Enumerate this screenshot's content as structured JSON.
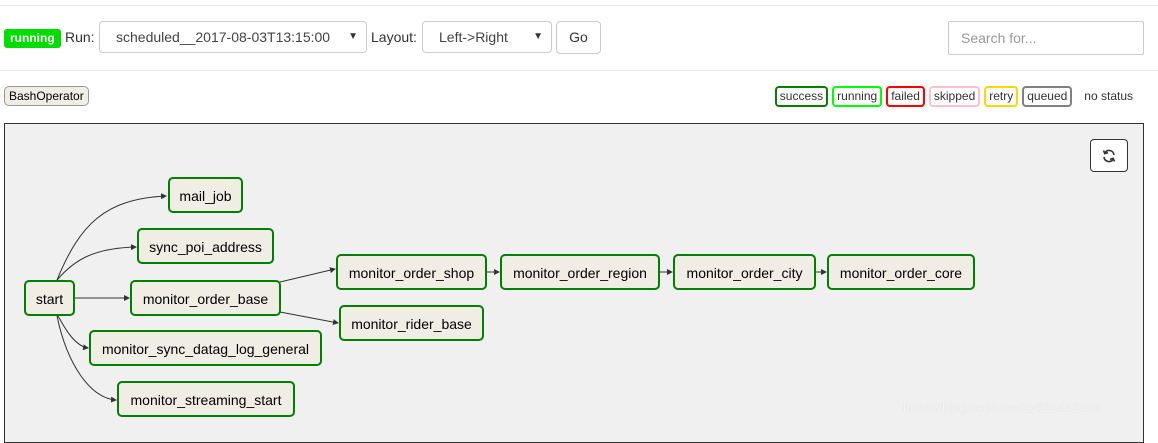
{
  "toolbar": {
    "state_badge": "running",
    "run_label": "Run:",
    "run_value": "scheduled__2017-08-03T13:15:00",
    "layout_label": "Layout:",
    "layout_value": "Left->Right",
    "go_label": "Go",
    "search_placeholder": "Search for..."
  },
  "operator_tag": "BashOperator",
  "legend": {
    "items": [
      {
        "label": "success",
        "color": "#008000"
      },
      {
        "label": "running",
        "color": "#00ff00"
      },
      {
        "label": "failed",
        "color": "#ff0000"
      },
      {
        "label": "skipped",
        "color": "#ffc0cb"
      },
      {
        "label": "retry",
        "color": "#ffd700"
      },
      {
        "label": "queued",
        "color": "#808080"
      }
    ],
    "no_status": "no status"
  },
  "graph": {
    "refresh_icon": "refresh-icon",
    "nodes": {
      "start": "start",
      "mail_job": "mail_job",
      "sync_poi_address": "sync_poi_address",
      "monitor_order_base": "monitor_order_base",
      "monitor_sync_datag_log_general": "monitor_sync_datag_log_general",
      "monitor_streaming_start": "monitor_streaming_start",
      "monitor_order_shop": "monitor_order_shop",
      "monitor_rider_base": "monitor_rider_base",
      "monitor_order_region": "monitor_order_region",
      "monitor_order_city": "monitor_order_city",
      "monitor_order_core": "monitor_order_core"
    }
  },
  "watermark": "https://blog.csdn.net/zy629442466"
}
